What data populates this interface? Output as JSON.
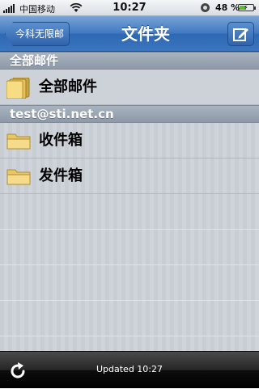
{
  "status_bar": {
    "carrier": "中国移动",
    "time": "10:27",
    "battery": "48 %",
    "battery_level": 0.48
  },
  "nav": {
    "back_label": "今科无限邮",
    "title": "文件夹",
    "compose_icon": "compose-icon"
  },
  "sections": [
    {
      "header": "全部邮件",
      "rows": [
        {
          "label": "全部邮件",
          "icon": "folder-stack-icon"
        }
      ]
    },
    {
      "header": "test@sti.net.cn",
      "rows": [
        {
          "label": "收件箱",
          "icon": "folder-icon"
        },
        {
          "label": "发件箱",
          "icon": "folder-icon"
        }
      ]
    }
  ],
  "toolbar": {
    "refresh_icon": "refresh-icon",
    "updated_text": "Updated 10:27"
  },
  "colors": {
    "nav_blue": "#3f78c0",
    "section_header": "#9aa5b3",
    "toolbar": "#000000"
  }
}
